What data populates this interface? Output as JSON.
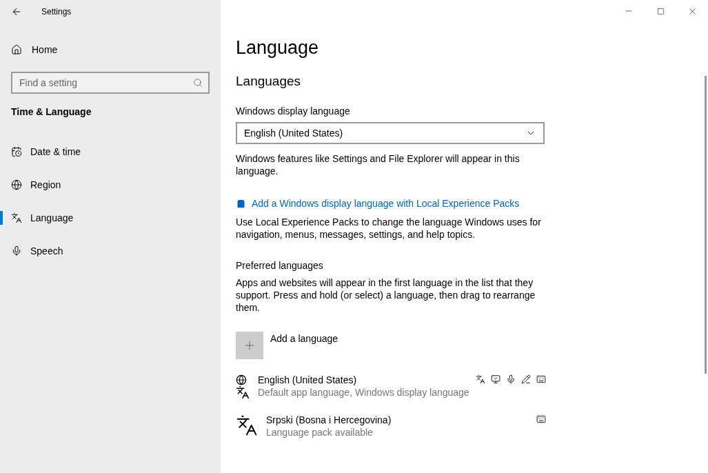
{
  "window": {
    "title": "Settings"
  },
  "sidebar": {
    "home": "Home",
    "search": {
      "placeholder": "Find a setting"
    },
    "section": "Time & Language",
    "items": [
      {
        "label": "Date & time",
        "kind": "calendar",
        "selected": false
      },
      {
        "label": "Region",
        "kind": "globe",
        "selected": false
      },
      {
        "label": "Language",
        "kind": "language",
        "selected": true
      },
      {
        "label": "Speech",
        "kind": "mic",
        "selected": false
      }
    ]
  },
  "page": {
    "title": "Language",
    "section": "Languages",
    "display_language": {
      "label": "Windows display language",
      "value": "English (United States)",
      "note": "Windows features like Settings and File Explorer will appear in this language."
    },
    "link": "Add a Windows display language with Local Experience Packs",
    "link_note": "Use Local Experience Packs to change the language Windows uses for navigation, menus, messages, settings, and help topics.",
    "preferred": {
      "label": "Preferred languages",
      "note": "Apps and websites will appear in the first language in the list that they support. Press and hold (or select) a language, then drag to rearrange them.",
      "add": "Add a language",
      "languages": [
        {
          "name": "English (United States)",
          "detail": "Default app language, Windows display language",
          "kind": "globe-language",
          "features": [
            {
              "kind": "language"
            },
            {
              "kind": "display"
            },
            {
              "kind": "mic"
            },
            {
              "kind": "handwriting"
            },
            {
              "kind": "keyboard"
            }
          ]
        },
        {
          "name": "Srpski (Bosna i Hercegovina)",
          "detail": "Language pack available",
          "kind": "language",
          "features": [
            {
              "kind": "keyboard"
            }
          ]
        }
      ]
    }
  }
}
